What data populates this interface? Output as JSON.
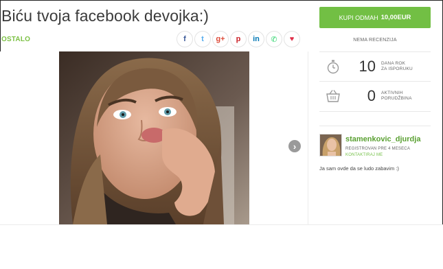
{
  "listing": {
    "title": "Biću tvoja facebook devojka:)",
    "category": "OSTALO"
  },
  "share": [
    {
      "name": "facebook",
      "glyph": "f",
      "color": "#3b5998"
    },
    {
      "name": "twitter",
      "glyph": "t",
      "color": "#55acee"
    },
    {
      "name": "google-plus",
      "glyph": "g+",
      "color": "#dd4b39"
    },
    {
      "name": "pinterest",
      "glyph": "p",
      "color": "#cb2027"
    },
    {
      "name": "linkedin",
      "glyph": "in",
      "color": "#0077b5"
    },
    {
      "name": "whatsapp",
      "glyph": "✆",
      "color": "#25d366"
    },
    {
      "name": "favorite",
      "glyph": "♥",
      "color": "#e0304a"
    }
  ],
  "gallery": {
    "next_glyph": "›"
  },
  "purchase": {
    "button_label": "KUPI ODMAH",
    "price": "10,00EUR",
    "accent": "#72bf44"
  },
  "reviews": {
    "label": "NEMA RECENZIJA"
  },
  "stats": {
    "delivery": {
      "value": "10",
      "line1": "DANA ROK",
      "line2": "ZA ISPORUKU"
    },
    "orders": {
      "value": "0",
      "line1": "AKTIVNIH",
      "line2": "PORUDŽBINA"
    }
  },
  "seller": {
    "username": "stamenkovic_djurdja",
    "registered": "REGISTROVAN PRE 4 MESECA",
    "contact": "KONTAKTIRAJ ME",
    "bio": "Ja sam ovde da se ludo zabavim :)"
  }
}
